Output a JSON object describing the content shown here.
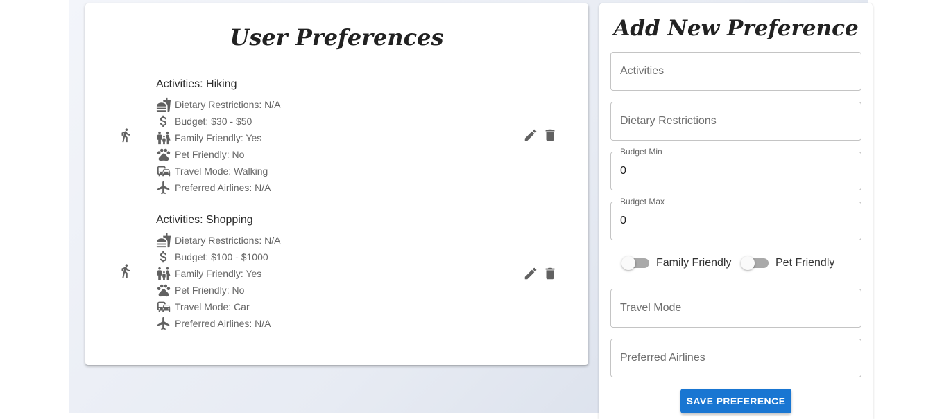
{
  "preferences_card": {
    "title": "User Preferences",
    "items": [
      {
        "activities": "Activities: Hiking",
        "dietary": "Dietary Restrictions: N/A",
        "budget": "Budget: $30 - $50",
        "family": "Family Friendly: Yes",
        "pet": "Pet Friendly: No",
        "travel": "Travel Mode: Walking",
        "airlines": "Preferred Airlines: N/A"
      },
      {
        "activities": "Activities: Shopping",
        "dietary": "Dietary Restrictions: N/A",
        "budget": "Budget: $100 - $1000",
        "family": "Family Friendly: Yes",
        "pet": "Pet Friendly: No",
        "travel": "Travel Mode: Car",
        "airlines": "Preferred Airlines: N/A"
      }
    ],
    "icons": {
      "item": "directions-run-icon",
      "dietary": "fastfood-icon",
      "budget": "attach-money-icon",
      "family": "family-icon",
      "pet": "pets-icon",
      "travel": "commute-icon",
      "airlines": "flight-icon",
      "edit": "edit-icon",
      "delete": "delete-icon"
    }
  },
  "form": {
    "title": "Add New Preference",
    "activities_placeholder": "Activities",
    "dietary_placeholder": "Dietary Restrictions",
    "budget_min_label": "Budget Min",
    "budget_min_value": "0",
    "budget_max_label": "Budget Max",
    "budget_max_value": "0",
    "family_friendly_label": "Family Friendly",
    "family_friendly_on": false,
    "pet_friendly_label": "Pet Friendly",
    "pet_friendly_on": false,
    "travel_mode_placeholder": "Travel Mode",
    "airlines_placeholder": "Preferred Airlines",
    "save_label": "SAVE PREFERENCE"
  },
  "colors": {
    "primary": "#1976d2",
    "icon": "#616161"
  }
}
